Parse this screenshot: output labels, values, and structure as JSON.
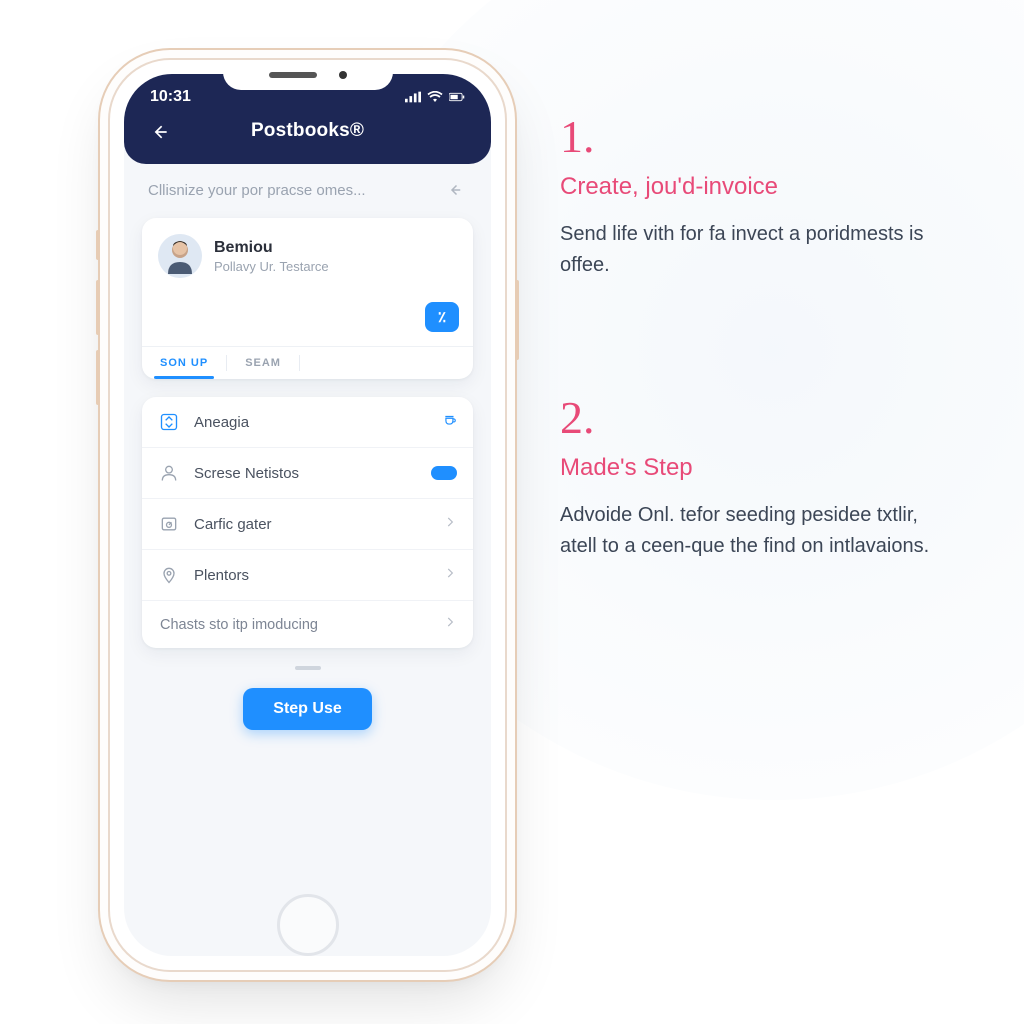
{
  "colors": {
    "accent_blue": "#1f8fff",
    "brand_navy": "#1d2755",
    "accent_pink": "#e84a78"
  },
  "status": {
    "time": "10:31"
  },
  "header": {
    "app_title": "Postbooks®"
  },
  "search": {
    "placeholder": "Cllisnize your por pracse omes..."
  },
  "user_card": {
    "name": "Bemiou",
    "subtitle": "Pollavy Ur. Testarce",
    "action_label": "٪"
  },
  "tabs": [
    {
      "label": "SON UP",
      "active": true
    },
    {
      "label": "SEAM",
      "active": false
    }
  ],
  "list": [
    {
      "icon": "swap-icon",
      "label": "Aneagia",
      "trail": "cup"
    },
    {
      "icon": "person-icon",
      "label": "Screse Netistos",
      "trail": "toggle"
    },
    {
      "icon": "gauge-icon",
      "label": "Carfic gater",
      "trail": "chevron"
    },
    {
      "icon": "pin-icon",
      "label": "Plentors",
      "trail": "chevron"
    },
    {
      "icon": "",
      "label": "Chasts sto itp imoducing",
      "trail": "chevron"
    }
  ],
  "cta": {
    "label": "Step Use"
  },
  "steps": [
    {
      "num": "1.",
      "title": "Create, jou'd-invoice",
      "body": "Send life vith for fa invect a poridmests is offee."
    },
    {
      "num": "2.",
      "title": "Made's Step",
      "body": "Advoide Onl. tefor seeding pesidee txtlir, atell to a ceen-que the find on intlavaions."
    }
  ]
}
